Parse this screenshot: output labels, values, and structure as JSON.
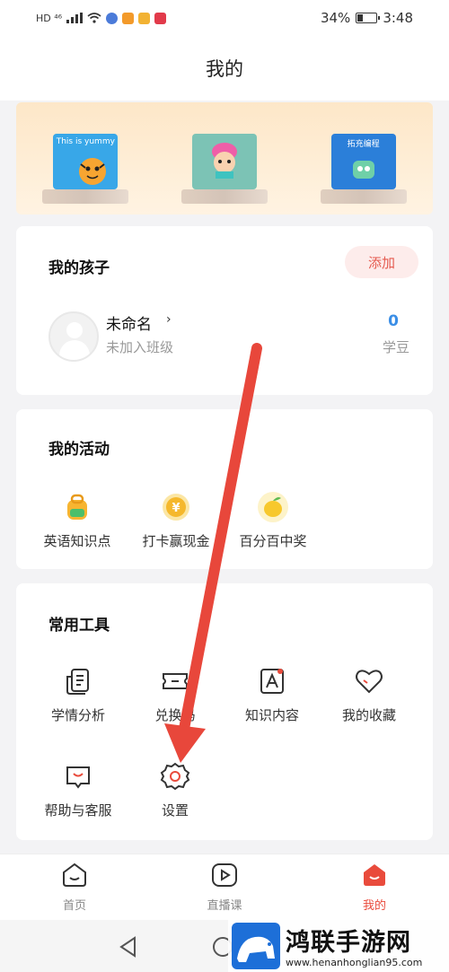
{
  "status_bar": {
    "left_text": "HD ⁴⁶",
    "battery": "34%",
    "time": "3:48",
    "battery_level": 0.34
  },
  "header": {
    "title": "我的"
  },
  "banner": {
    "items": [
      {
        "cover_text": "This is yummy",
        "cover_color": "#38a7e8"
      },
      {
        "cover_text": "",
        "cover_color": "#7cc3b5"
      },
      {
        "cover_text": "拓充编程",
        "cover_color": "#2b7fd9"
      }
    ]
  },
  "children_card": {
    "title": "我的孩子",
    "add_label": "添加",
    "child_name": "未命名",
    "child_status": "未加入班级",
    "beans_count": "0",
    "beans_label": "学豆"
  },
  "activities_card": {
    "title": "我的活动",
    "items": [
      {
        "label": "英语知识点",
        "icon": "backpack-icon"
      },
      {
        "label": "打卡赢现金",
        "icon": "coin-icon"
      },
      {
        "label": "百分百中奖",
        "icon": "lemon-icon"
      }
    ]
  },
  "tools_card": {
    "title": "常用工具",
    "items": [
      {
        "label": "学情分析",
        "icon": "report-icon"
      },
      {
        "label": "兑换码",
        "icon": "ticket-icon"
      },
      {
        "label": "知识内容",
        "icon": "knowledge-icon"
      },
      {
        "label": "我的收藏",
        "icon": "heart-icon"
      },
      {
        "label": "帮助与客服",
        "icon": "help-icon"
      },
      {
        "label": "设置",
        "icon": "gear-icon"
      }
    ]
  },
  "bottom_nav": {
    "items": [
      {
        "label": "首页",
        "icon": "home-icon"
      },
      {
        "label": "直播课",
        "icon": "play-icon"
      },
      {
        "label": "我的",
        "icon": "profile-icon"
      }
    ],
    "active_index": 2
  },
  "watermark": {
    "title": "鸿联手游网",
    "url": "www.henanhonglian95.com"
  },
  "colors": {
    "accent": "#e94b3c",
    "beans": "#3a8ee6",
    "add_bg": "#fdeceb",
    "arrow": "#e8473b"
  }
}
